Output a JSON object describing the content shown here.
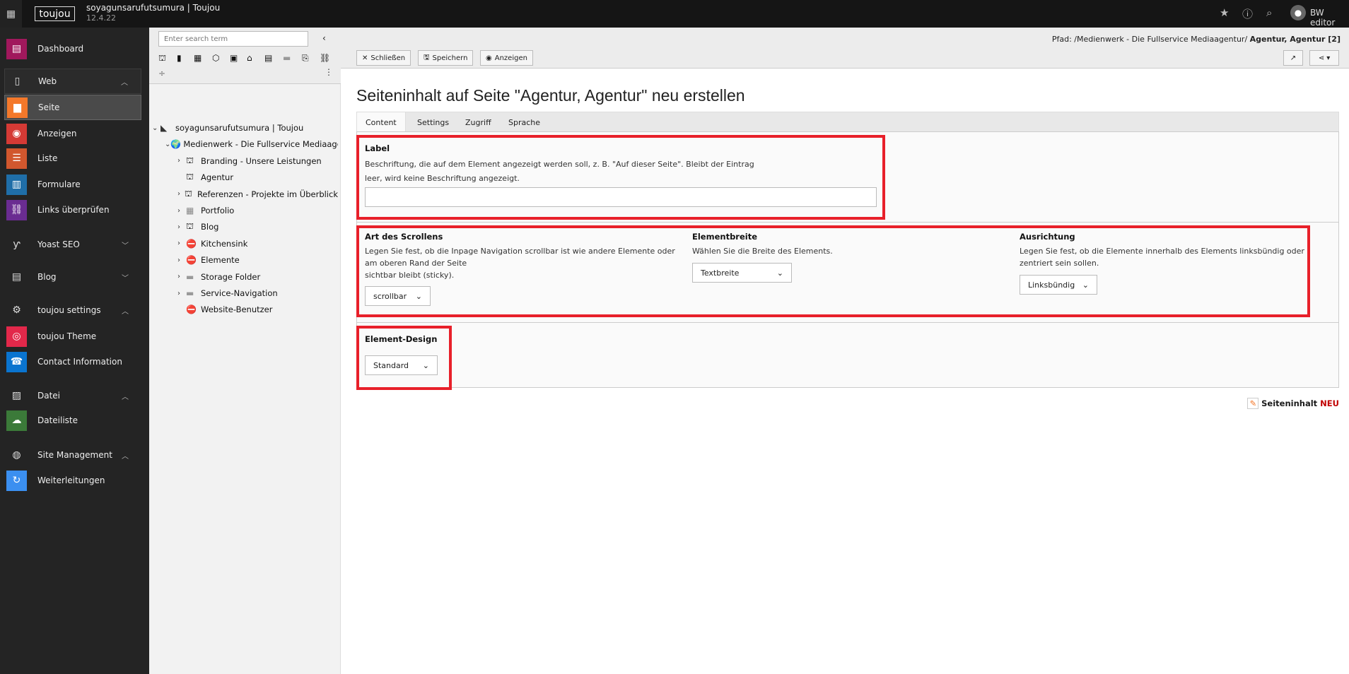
{
  "topbar": {
    "logo": "toujou",
    "site_name": "soyagunsarufutsumura | Toujou",
    "version": "12.4.22",
    "user": "BW editor",
    "icons": [
      "apps-grid-icon",
      "star-icon",
      "help-icon",
      "search-icon",
      "user-avatar-icon"
    ]
  },
  "sidebar": {
    "items": [
      {
        "label": "Dashboard",
        "icon": "dashboard-icon",
        "color": "#a0185c"
      },
      {
        "label": "Web",
        "group": true,
        "expanded": true
      },
      {
        "label": "Seite",
        "icon": "page-icon",
        "color": "#f4782a",
        "active": true
      },
      {
        "label": "Anzeigen",
        "icon": "eye-icon",
        "color": "#d53a35"
      },
      {
        "label": "Liste",
        "icon": "list-icon",
        "color": "#d1572e"
      },
      {
        "label": "Formulare",
        "icon": "form-icon",
        "color": "#1f6ea8"
      },
      {
        "label": "Links überprüfen",
        "icon": "link-icon",
        "color": "#6a2c91"
      },
      {
        "label": "Yoast SEO",
        "group": true,
        "expanded": false
      },
      {
        "label": "Blog",
        "group": true,
        "expanded": false
      },
      {
        "label": "toujou settings",
        "group": true,
        "expanded": true
      },
      {
        "label": "toujou Theme",
        "icon": "fingerprint-icon",
        "color": "#e2284a"
      },
      {
        "label": "Contact Information",
        "icon": "contact-icon",
        "color": "#0a74cf"
      },
      {
        "label": "Datei",
        "group": true,
        "expanded": true
      },
      {
        "label": "Dateiliste",
        "icon": "cloud-icon",
        "color": "#3b7a39"
      },
      {
        "label": "Site Management",
        "group": true,
        "expanded": true
      },
      {
        "label": "Weiterleitungen",
        "icon": "redirect-icon",
        "color": "#3b8ff0"
      }
    ]
  },
  "tree": {
    "search_placeholder": "Enter search term",
    "items": [
      {
        "label": "soyagunsarufutsumura | Toujou",
        "level": 0,
        "toggle": "open",
        "icon": "typo3-icon"
      },
      {
        "label": "Medienwerk - Die Fullservice Mediaagentur",
        "level": 1,
        "toggle": "open",
        "icon": "globe-icon"
      },
      {
        "label": "Branding - Unsere Leistungen",
        "level": 2,
        "toggle": "closed",
        "icon": "shortcut-page-icon"
      },
      {
        "label": "Agentur",
        "level": 2,
        "toggle": "",
        "icon": "shortcut-page-icon"
      },
      {
        "label": "Referenzen - Projekte im Überblick",
        "level": 2,
        "toggle": "closed",
        "icon": "shortcut-page-icon"
      },
      {
        "label": "Portfolio",
        "level": 2,
        "toggle": "closed",
        "icon": "grid-page-icon"
      },
      {
        "label": "Blog",
        "level": 2,
        "toggle": "closed",
        "icon": "shortcut-page-icon"
      },
      {
        "label": "Kitchensink",
        "level": 2,
        "toggle": "closed",
        "icon": "hidden-page-icon"
      },
      {
        "label": "Elemente",
        "level": 2,
        "toggle": "closed",
        "icon": "hidden-page-icon"
      },
      {
        "label": "Storage Folder",
        "level": 2,
        "toggle": "closed",
        "icon": "folder-icon"
      },
      {
        "label": "Service-Navigation",
        "level": 2,
        "toggle": "closed",
        "icon": "folder-icon"
      },
      {
        "label": "Website-Benutzer",
        "level": 2,
        "toggle": "",
        "icon": "hidden-folder-icon"
      }
    ]
  },
  "docheader": {
    "close": "Schließen",
    "save": "Speichern",
    "view": "Anzeigen",
    "path_label": "Pfad: /Medienwerk - Die Fullservice Mediaagentur/",
    "path_page": "Agentur, Agentur [2]"
  },
  "main": {
    "title": "Seiteninhalt auf Seite \"Agentur, Agentur\" neu erstellen",
    "tabs": [
      "Content",
      "Settings",
      "Zugriff",
      "Sprache"
    ],
    "label_field": {
      "label": "Label",
      "desc1": "Beschriftung, die auf dem Element angezeigt werden soll, z. B. \"Auf dieser Seite\". Bleibt der Eintrag",
      "desc2": "leer, wird keine Beschriftung angezeigt.",
      "value": ""
    },
    "scroll": {
      "label": "Art des Scrollens",
      "desc1": "Legen Sie fest, ob die Inpage Navigation scrollbar ist wie andere Elemente oder",
      "desc2": "am oberen Rand der Seite",
      "desc3": "sichtbar bleibt (sticky).",
      "value": "scrollbar"
    },
    "width": {
      "label": "Elementbreite",
      "desc": "Wählen Sie die Breite des Elements.",
      "value": "Textbreite"
    },
    "align": {
      "label": "Ausrichtung",
      "desc1": "Legen Sie fest, ob die Elemente innerhalb des Elements linksbündig oder",
      "desc2": "zentriert sein sollen.",
      "value": "Linksbündig"
    },
    "design": {
      "label": "Element-Design",
      "value": "Standard"
    },
    "record": {
      "type": "Seiteninhalt",
      "status": "NEU",
      "status_color": "#c00000"
    }
  },
  "highlight_color": "#e8202a"
}
